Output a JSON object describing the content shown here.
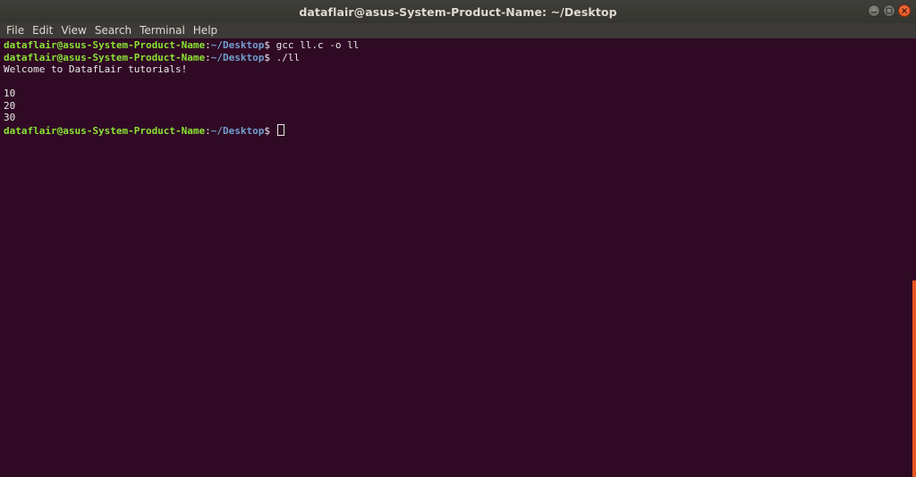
{
  "window": {
    "title": "dataflair@asus-System-Product-Name: ~/Desktop"
  },
  "menu": {
    "items": [
      "File",
      "Edit",
      "View",
      "Search",
      "Terminal",
      "Help"
    ]
  },
  "terminal": {
    "prompt_user": "dataflair@asus-System-Product-Name",
    "prompt_sep": ":",
    "prompt_path": "~/Desktop",
    "prompt_symbol": "$",
    "command1": " gcc ll.c -o ll",
    "command2": " ./ll",
    "output": [
      "Welcome to DatafLair tutorials!",
      "",
      "10",
      "20",
      "30"
    ]
  },
  "colors": {
    "background": "#300a24",
    "user": "#8ae234",
    "path": "#729fcf",
    "text": "#e9e9e9",
    "accent": "#e95420"
  },
  "icons": {
    "minimize": "minimize-icon",
    "maximize": "maximize-icon",
    "close": "close-icon"
  }
}
